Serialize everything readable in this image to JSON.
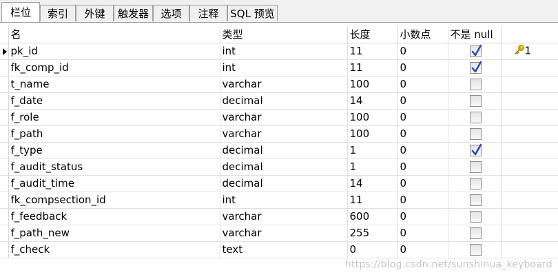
{
  "tabs": [
    {
      "label": "栏位",
      "active": true
    },
    {
      "label": "索引",
      "active": false
    },
    {
      "label": "外键",
      "active": false
    },
    {
      "label": "触发器",
      "active": false
    },
    {
      "label": "选项",
      "active": false
    },
    {
      "label": "注释",
      "active": false
    },
    {
      "label": "SQL 预览",
      "active": false
    }
  ],
  "columns": {
    "name": "名",
    "type": "类型",
    "length": "长度",
    "decimals": "小数点",
    "not_null": "不是 null"
  },
  "rows": [
    {
      "name": "pk_id",
      "type": "int",
      "length": "11",
      "decimals": "0",
      "not_null": true,
      "key": "1",
      "selected": true
    },
    {
      "name": "fk_comp_id",
      "type": "int",
      "length": "11",
      "decimals": "0",
      "not_null": true,
      "key": ""
    },
    {
      "name": "t_name",
      "type": "varchar",
      "length": "100",
      "decimals": "0",
      "not_null": false,
      "key": ""
    },
    {
      "name": "f_date",
      "type": "decimal",
      "length": "14",
      "decimals": "0",
      "not_null": false,
      "key": ""
    },
    {
      "name": "f_role",
      "type": "varchar",
      "length": "100",
      "decimals": "0",
      "not_null": false,
      "key": ""
    },
    {
      "name": "f_path",
      "type": "varchar",
      "length": "100",
      "decimals": "0",
      "not_null": false,
      "key": ""
    },
    {
      "name": "f_type",
      "type": "decimal",
      "length": "1",
      "decimals": "0",
      "not_null": true,
      "key": ""
    },
    {
      "name": "f_audit_status",
      "type": "decimal",
      "length": "1",
      "decimals": "0",
      "not_null": false,
      "key": ""
    },
    {
      "name": "f_audit_time",
      "type": "decimal",
      "length": "14",
      "decimals": "0",
      "not_null": false,
      "key": ""
    },
    {
      "name": "fk_compsection_id",
      "type": "int",
      "length": "11",
      "decimals": "0",
      "not_null": false,
      "key": ""
    },
    {
      "name": "f_feedback",
      "type": "varchar",
      "length": "600",
      "decimals": "0",
      "not_null": false,
      "key": ""
    },
    {
      "name": "f_path_new",
      "type": "varchar",
      "length": "255",
      "decimals": "0",
      "not_null": false,
      "key": ""
    },
    {
      "name": "f_check",
      "type": "text",
      "length": "0",
      "decimals": "0",
      "not_null": false,
      "key": ""
    }
  ],
  "icons": {
    "selected_row": "row-pointer-icon",
    "primary_key": "key-icon",
    "checked": "checkmark-icon"
  },
  "colors": {
    "check": "#2b4fa8",
    "key": "#e0b000"
  },
  "watermark": "https://blog.csdn.net/sunshinua_keyboard"
}
